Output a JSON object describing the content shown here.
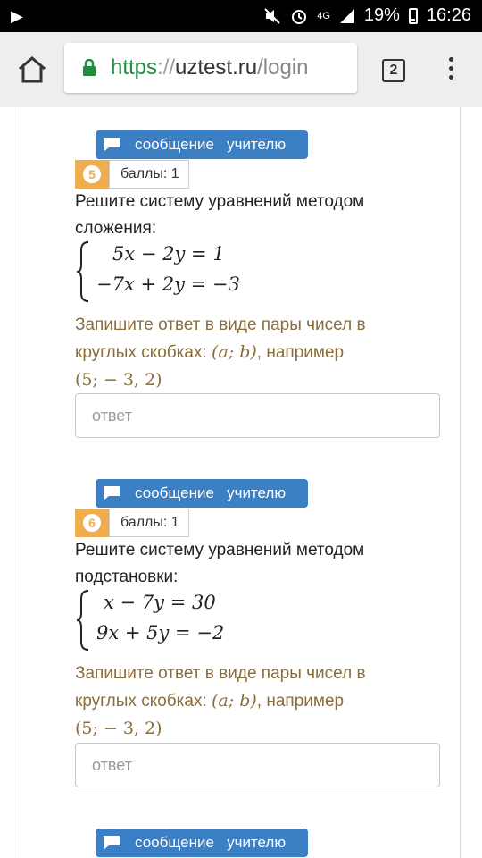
{
  "status_bar": {
    "play_glyph": "▶",
    "network": "4G",
    "battery_percent": "19%",
    "time": "16:26",
    "icons": [
      "play-icon",
      "mute-icon",
      "alarm-icon",
      "signal-icon",
      "battery-icon"
    ]
  },
  "browser": {
    "url_protocol": "https",
    "url_separator": "://",
    "url_host": "uztest.ru",
    "url_path": "/login",
    "tab_count": "2",
    "secure_color": "#1e8e3e"
  },
  "colors": {
    "accent": "#3b7fc4",
    "badge": "#f0ad4e",
    "hint": "#8a6d3b"
  },
  "questions": [
    {
      "message_label": "сообщение   учителю",
      "number": "5",
      "score": "баллы: 1",
      "text_line1": "Решите систему уравнений методом",
      "text_line2": "сложения:",
      "eq1": "5x − 2y = 1",
      "eq2": "−7x + 2y = −3",
      "hint_line1": "Запишите ответ в виде пары чисел в",
      "hint_line2_prefix": "круглых скобках: ",
      "hint_math": "(a; b)",
      "hint_line2_suffix": ", например",
      "hint_example": "(5;  − 3, 2)",
      "placeholder": "ответ"
    },
    {
      "message_label": "сообщение   учителю",
      "number": "6",
      "score": "баллы: 1",
      "text_line1": "Решите систему уравнений методом",
      "text_line2": "подстановки:",
      "eq1": "x − 7y = 30",
      "eq2": "9x + 5y = −2",
      "hint_line1": "Запишите ответ в виде пары чисел в",
      "hint_line2_prefix": "круглых скобках: ",
      "hint_math": "(a; b)",
      "hint_line2_suffix": ", например",
      "hint_example": "(5;  − 3, 2)",
      "placeholder": "ответ"
    },
    {
      "message_label": "сообщение   учителю"
    }
  ]
}
